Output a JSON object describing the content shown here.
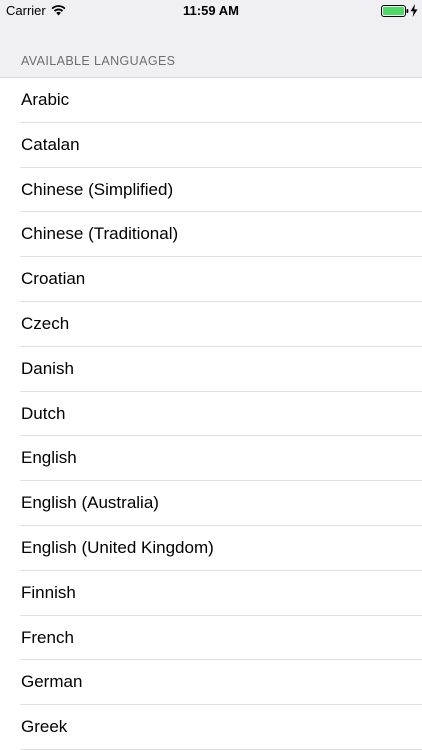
{
  "status_bar": {
    "carrier": "Carrier",
    "time": "11:59 AM",
    "wifi_icon": "wifi-icon",
    "battery_icon": "battery-icon",
    "battery_color": "#4cd964",
    "charging_icon": "bolt-icon"
  },
  "section": {
    "title": "AVAILABLE LANGUAGES"
  },
  "languages": [
    {
      "label": "Arabic"
    },
    {
      "label": "Catalan"
    },
    {
      "label": "Chinese (Simplified)"
    },
    {
      "label": "Chinese (Traditional)"
    },
    {
      "label": "Croatian"
    },
    {
      "label": "Czech"
    },
    {
      "label": "Danish"
    },
    {
      "label": "Dutch"
    },
    {
      "label": "English"
    },
    {
      "label": "English (Australia)"
    },
    {
      "label": "English (United Kingdom)"
    },
    {
      "label": "Finnish"
    },
    {
      "label": "French"
    },
    {
      "label": "German"
    },
    {
      "label": "Greek"
    }
  ]
}
